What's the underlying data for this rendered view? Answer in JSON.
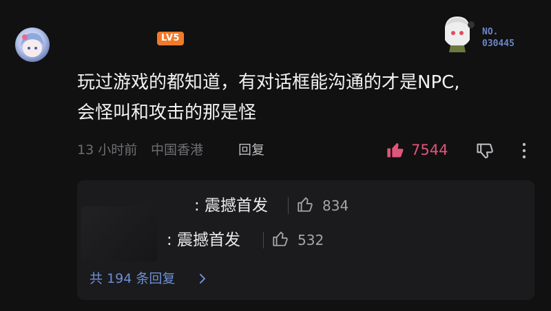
{
  "comment": {
    "level_badge": "LV5",
    "badge_no_label": "NO.",
    "badge_no_value": "030445",
    "text_line1": "玩过游戏的都知道，有对话框能沟通的才是NPC,",
    "text_line2": "会怪叫和攻击的那是怪",
    "time": "13 小时前",
    "location": "中国香港",
    "reply_label": "回复",
    "like_count": "7544"
  },
  "replies": {
    "items": [
      {
        "text": ": 震撼首发",
        "like_count": "834"
      },
      {
        "text": ": 震撼首发",
        "like_count": "532"
      }
    ],
    "all_replies_label": "共 194 条回复"
  },
  "colors": {
    "like_accent": "#e0557a",
    "link": "#6d8fd6",
    "level_badge": "#f07a2a"
  },
  "icons": [
    "avatar",
    "thumb-up-icon",
    "thumb-down-icon",
    "more-icon",
    "chevron-right-icon"
  ]
}
